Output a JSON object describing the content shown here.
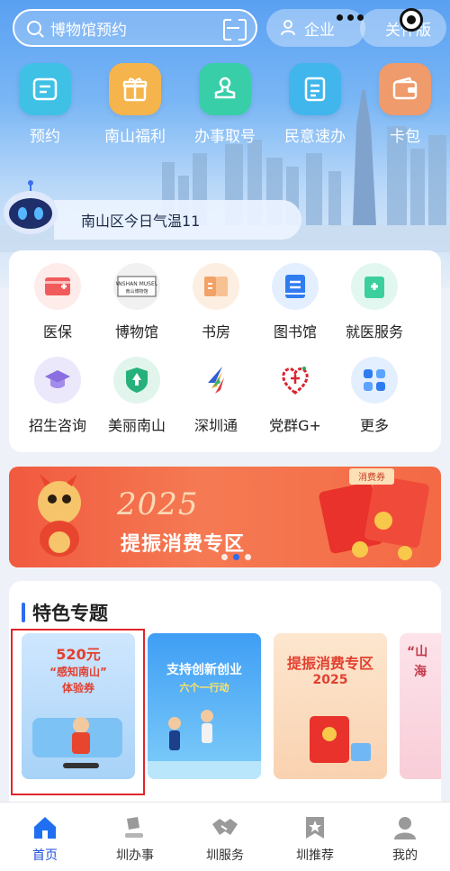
{
  "top_bar": {
    "search_placeholder": "博物馆预约",
    "enterprise_label": "企业",
    "care_label": "关怀版"
  },
  "quick_actions": [
    {
      "label": "预约",
      "icon": "calendar-icon",
      "color": "#3fc1e6"
    },
    {
      "label": "南山福利",
      "icon": "gift-icon",
      "color": "#f5b44c"
    },
    {
      "label": "办事取号",
      "icon": "stamp-icon",
      "color": "#38cfa8"
    },
    {
      "label": "民意速办",
      "icon": "document-icon",
      "color": "#40b6ec"
    },
    {
      "label": "卡包",
      "icon": "wallet-icon",
      "color": "#ef9b6b"
    }
  ],
  "weather_text": "南山区今日气温11",
  "services": [
    {
      "label": "医保",
      "icon": "medical-card-icon"
    },
    {
      "label": "博物馆",
      "icon": "museum-icon",
      "logo_text": "NANSHAN MUSEUM 南山博物馆"
    },
    {
      "label": "书房",
      "icon": "book-icon"
    },
    {
      "label": "图书馆",
      "icon": "library-icon"
    },
    {
      "label": "就医服务",
      "icon": "hospital-icon"
    },
    {
      "label": "招生咨询",
      "icon": "graduation-cap-icon"
    },
    {
      "label": "美丽南山",
      "icon": "park-badge-icon"
    },
    {
      "label": "深圳通",
      "icon": "shenzhen-tong-icon"
    },
    {
      "label": "党群G+",
      "icon": "party-emblem-icon"
    },
    {
      "label": "更多",
      "icon": "grid-more-icon"
    }
  ],
  "banner": {
    "year_text": "2025",
    "title": "提振消费专区",
    "coupon_text": "消费券",
    "page_count": 3,
    "active_page": 2
  },
  "featured": {
    "title": "特色专题",
    "cards": [
      {
        "line1": "520元",
        "line2": "“感知南山”",
        "line3": "体验券"
      },
      {
        "line1": "支持创新创业",
        "line2": "六个一行动"
      },
      {
        "line1": "提振消费专区",
        "line2": "2025"
      },
      {
        "line1": "“山",
        "line2": "海"
      }
    ]
  },
  "tabs": [
    {
      "label": "首页",
      "icon": "home-icon",
      "active": true
    },
    {
      "label": "圳办事",
      "icon": "gavel-icon",
      "active": false
    },
    {
      "label": "圳服务",
      "icon": "handshake-icon",
      "active": false
    },
    {
      "label": "圳推荐",
      "icon": "star-bookmark-icon",
      "active": false
    },
    {
      "label": "我的",
      "icon": "user-icon",
      "active": false
    }
  ],
  "colors": {
    "accent": "#2f6cf0",
    "active_tab": "#1f4fd6",
    "selection_border": "#e0262b"
  }
}
